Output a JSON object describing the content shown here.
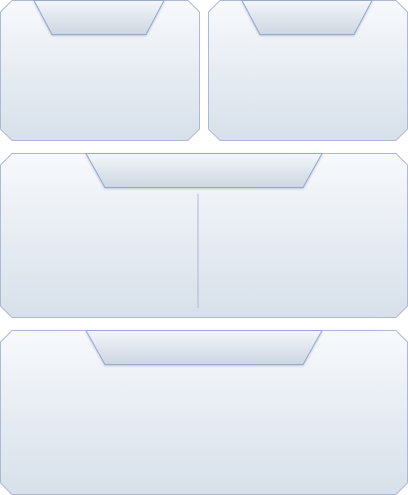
{
  "window": {
    "background": "#ffffff"
  },
  "theme": {
    "panel_fill_top": "#f7f9fc",
    "panel_fill_bottom": "#d7e0ea",
    "panel_border": "#aeb9d4",
    "tab_fill_top": "#f3f6fa",
    "tab_fill_bottom": "#cdd6e2",
    "tab_border": "#9aa9c9",
    "divider": "#aeb9cf"
  },
  "panels": [
    {
      "id": "top-left-panel",
      "tab_label": ""
    },
    {
      "id": "top-right-panel",
      "tab_label": ""
    },
    {
      "id": "middle-panel",
      "tab_label": "",
      "split": true
    },
    {
      "id": "bottom-panel",
      "tab_label": ""
    }
  ]
}
